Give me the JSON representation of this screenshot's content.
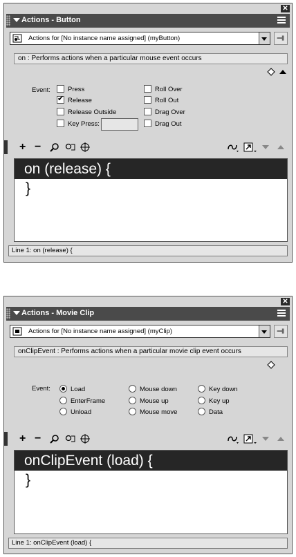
{
  "panels": [
    {
      "title": "Actions - Button",
      "target_select": "Actions for [No instance name assigned] (myButton)",
      "description": "on : Performs actions when a particular mouse event occurs",
      "event_label": "Event:",
      "options": [
        {
          "label": "Press",
          "checked": false
        },
        {
          "label": "Release",
          "checked": true
        },
        {
          "label": "Release Outside",
          "checked": false
        },
        {
          "label": "Key Press:",
          "checked": false
        },
        {
          "label": "Roll Over",
          "checked": false
        },
        {
          "label": "Roll Out",
          "checked": false
        },
        {
          "label": "Drag Over",
          "checked": false
        },
        {
          "label": "Drag Out",
          "checked": false
        }
      ],
      "key_press_value": "",
      "code_lines": [
        "on (release) {",
        "}"
      ],
      "status": "Line 1: on (release) {"
    },
    {
      "title": "Actions - Movie Clip",
      "target_select": "Actions for [No instance name assigned] (myClip)",
      "description": "onClipEvent : Performs actions when a particular movie clip event occurs",
      "event_label": "Event:",
      "options": [
        {
          "label": "Load",
          "checked": true
        },
        {
          "label": "EnterFrame",
          "checked": false
        },
        {
          "label": "Unload",
          "checked": false
        },
        {
          "label": "Mouse down",
          "checked": false
        },
        {
          "label": "Mouse up",
          "checked": false
        },
        {
          "label": "Mouse move",
          "checked": false
        },
        {
          "label": "Key down",
          "checked": false
        },
        {
          "label": "Key up",
          "checked": false
        },
        {
          "label": "Data",
          "checked": false
        }
      ],
      "code_lines": [
        "onClipEvent (load) {",
        "}"
      ],
      "status": "Line 1: onClipEvent (load) {"
    }
  ],
  "toolbar": {
    "add_label": "+",
    "remove_label": "−",
    "icons": [
      "plus-icon",
      "minus-icon",
      "find-icon",
      "replace-icon",
      "target-icon",
      "debug-icon",
      "view-options-icon",
      "move-down-icon",
      "move-up-icon"
    ]
  },
  "colors": {
    "panel_bg": "#d6d6d6",
    "titlebar_bg": "#4a4a4a",
    "code_highlight_bg": "#262626"
  }
}
